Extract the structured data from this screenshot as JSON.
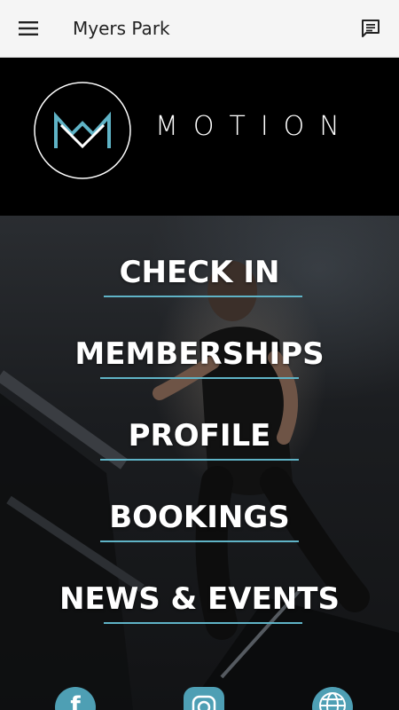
{
  "appbar": {
    "title": "Myers Park"
  },
  "brand": {
    "wordmark": "MOTION"
  },
  "menu": {
    "items": [
      {
        "label": "CHECK IN"
      },
      {
        "label": "MEMBERSHIPS"
      },
      {
        "label": "PROFILE"
      },
      {
        "label": "BOOKINGS"
      },
      {
        "label": "NEWS & EVENTS"
      }
    ]
  },
  "social": [
    "facebook-icon",
    "instagram-icon",
    "globe-icon"
  ],
  "colors": {
    "accent": "#5fb3c6",
    "appbar": "#f5f5f5",
    "logo_bg": "#000000"
  }
}
